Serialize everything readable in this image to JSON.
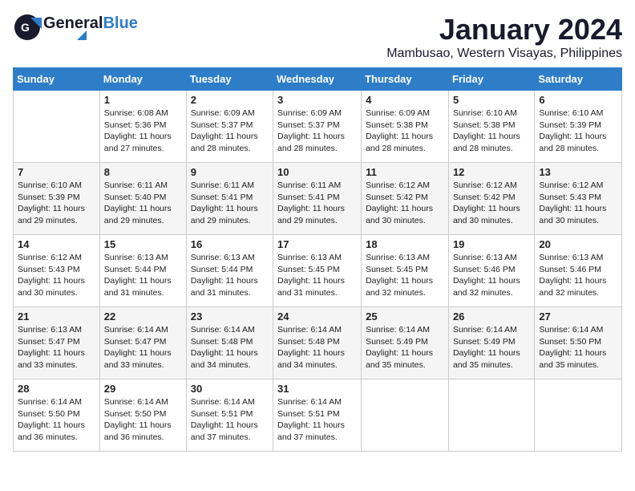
{
  "header": {
    "logo_general": "General",
    "logo_blue": "Blue",
    "month_title": "January 2024",
    "location": "Mambusao, Western Visayas, Philippines"
  },
  "days_of_week": [
    "Sunday",
    "Monday",
    "Tuesday",
    "Wednesday",
    "Thursday",
    "Friday",
    "Saturday"
  ],
  "weeks": [
    [
      {
        "day": "",
        "info": ""
      },
      {
        "day": "1",
        "info": "Sunrise: 6:08 AM\nSunset: 5:36 PM\nDaylight: 11 hours\nand 27 minutes."
      },
      {
        "day": "2",
        "info": "Sunrise: 6:09 AM\nSunset: 5:37 PM\nDaylight: 11 hours\nand 28 minutes."
      },
      {
        "day": "3",
        "info": "Sunrise: 6:09 AM\nSunset: 5:37 PM\nDaylight: 11 hours\nand 28 minutes."
      },
      {
        "day": "4",
        "info": "Sunrise: 6:09 AM\nSunset: 5:38 PM\nDaylight: 11 hours\nand 28 minutes."
      },
      {
        "day": "5",
        "info": "Sunrise: 6:10 AM\nSunset: 5:38 PM\nDaylight: 11 hours\nand 28 minutes."
      },
      {
        "day": "6",
        "info": "Sunrise: 6:10 AM\nSunset: 5:39 PM\nDaylight: 11 hours\nand 28 minutes."
      }
    ],
    [
      {
        "day": "7",
        "info": "Sunrise: 6:10 AM\nSunset: 5:39 PM\nDaylight: 11 hours\nand 29 minutes."
      },
      {
        "day": "8",
        "info": "Sunrise: 6:11 AM\nSunset: 5:40 PM\nDaylight: 11 hours\nand 29 minutes."
      },
      {
        "day": "9",
        "info": "Sunrise: 6:11 AM\nSunset: 5:41 PM\nDaylight: 11 hours\nand 29 minutes."
      },
      {
        "day": "10",
        "info": "Sunrise: 6:11 AM\nSunset: 5:41 PM\nDaylight: 11 hours\nand 29 minutes."
      },
      {
        "day": "11",
        "info": "Sunrise: 6:12 AM\nSunset: 5:42 PM\nDaylight: 11 hours\nand 30 minutes."
      },
      {
        "day": "12",
        "info": "Sunrise: 6:12 AM\nSunset: 5:42 PM\nDaylight: 11 hours\nand 30 minutes."
      },
      {
        "day": "13",
        "info": "Sunrise: 6:12 AM\nSunset: 5:43 PM\nDaylight: 11 hours\nand 30 minutes."
      }
    ],
    [
      {
        "day": "14",
        "info": "Sunrise: 6:12 AM\nSunset: 5:43 PM\nDaylight: 11 hours\nand 30 minutes."
      },
      {
        "day": "15",
        "info": "Sunrise: 6:13 AM\nSunset: 5:44 PM\nDaylight: 11 hours\nand 31 minutes."
      },
      {
        "day": "16",
        "info": "Sunrise: 6:13 AM\nSunset: 5:44 PM\nDaylight: 11 hours\nand 31 minutes."
      },
      {
        "day": "17",
        "info": "Sunrise: 6:13 AM\nSunset: 5:45 PM\nDaylight: 11 hours\nand 31 minutes."
      },
      {
        "day": "18",
        "info": "Sunrise: 6:13 AM\nSunset: 5:45 PM\nDaylight: 11 hours\nand 32 minutes."
      },
      {
        "day": "19",
        "info": "Sunrise: 6:13 AM\nSunset: 5:46 PM\nDaylight: 11 hours\nand 32 minutes."
      },
      {
        "day": "20",
        "info": "Sunrise: 6:13 AM\nSunset: 5:46 PM\nDaylight: 11 hours\nand 32 minutes."
      }
    ],
    [
      {
        "day": "21",
        "info": "Sunrise: 6:13 AM\nSunset: 5:47 PM\nDaylight: 11 hours\nand 33 minutes."
      },
      {
        "day": "22",
        "info": "Sunrise: 6:14 AM\nSunset: 5:47 PM\nDaylight: 11 hours\nand 33 minutes."
      },
      {
        "day": "23",
        "info": "Sunrise: 6:14 AM\nSunset: 5:48 PM\nDaylight: 11 hours\nand 34 minutes."
      },
      {
        "day": "24",
        "info": "Sunrise: 6:14 AM\nSunset: 5:48 PM\nDaylight: 11 hours\nand 34 minutes."
      },
      {
        "day": "25",
        "info": "Sunrise: 6:14 AM\nSunset: 5:49 PM\nDaylight: 11 hours\nand 35 minutes."
      },
      {
        "day": "26",
        "info": "Sunrise: 6:14 AM\nSunset: 5:49 PM\nDaylight: 11 hours\nand 35 minutes."
      },
      {
        "day": "27",
        "info": "Sunrise: 6:14 AM\nSunset: 5:50 PM\nDaylight: 11 hours\nand 35 minutes."
      }
    ],
    [
      {
        "day": "28",
        "info": "Sunrise: 6:14 AM\nSunset: 5:50 PM\nDaylight: 11 hours\nand 36 minutes."
      },
      {
        "day": "29",
        "info": "Sunrise: 6:14 AM\nSunset: 5:50 PM\nDaylight: 11 hours\nand 36 minutes."
      },
      {
        "day": "30",
        "info": "Sunrise: 6:14 AM\nSunset: 5:51 PM\nDaylight: 11 hours\nand 37 minutes."
      },
      {
        "day": "31",
        "info": "Sunrise: 6:14 AM\nSunset: 5:51 PM\nDaylight: 11 hours\nand 37 minutes."
      },
      {
        "day": "",
        "info": ""
      },
      {
        "day": "",
        "info": ""
      },
      {
        "day": "",
        "info": ""
      }
    ]
  ]
}
